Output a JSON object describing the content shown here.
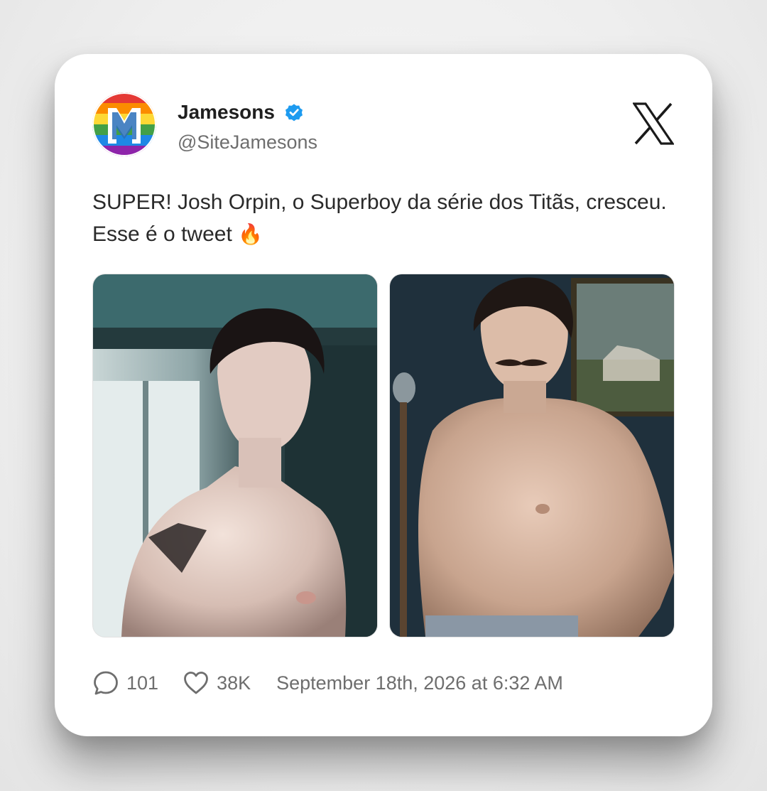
{
  "author": {
    "display_name": "Jamesons",
    "handle": "@SiteJamesons",
    "verified": true,
    "avatar_icon": "jamesons-logo-rainbow"
  },
  "platform_icon": "x-logo",
  "tweet": {
    "text": "SUPER! Josh Orpin, o Superboy da série dos Titãs, cresceu. Esse é o tweet",
    "emoji": "🔥"
  },
  "media": [
    {
      "icon": "photo-shirtless-man-superman-tattoo"
    },
    {
      "icon": "photo-shirtless-man-mustache"
    }
  ],
  "stats": {
    "replies": "101",
    "likes": "38K",
    "timestamp": "September 18th, 2026 at 6:32 AM"
  },
  "colors": {
    "verified": "#1d9bf0",
    "text": "#2a2a2a",
    "muted": "#6e6e6e",
    "card": "#ffffff"
  }
}
